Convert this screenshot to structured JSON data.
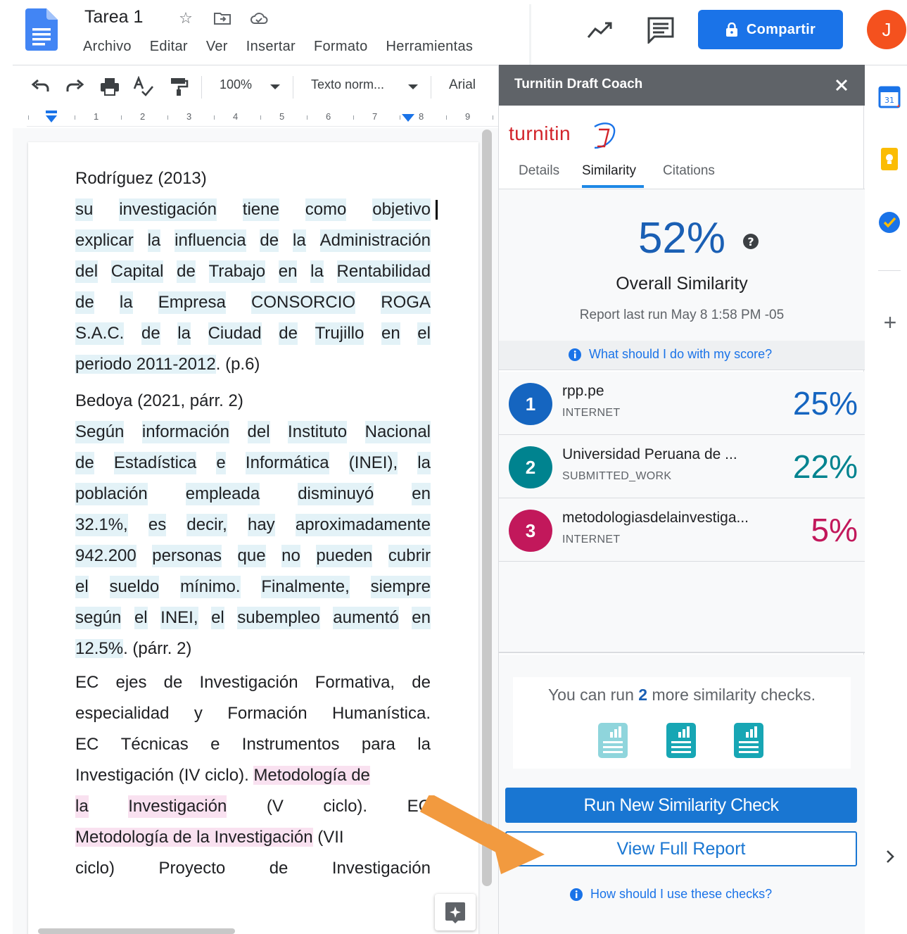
{
  "header": {
    "title": "Tarea 1",
    "menu": [
      "Archivo",
      "Editar",
      "Ver",
      "Insertar",
      "Formato",
      "Herramientas"
    ],
    "share_label": "Compartir",
    "avatar_initial": "J"
  },
  "toolbar": {
    "zoom": "100%",
    "style": "Texto norm...",
    "font": "Arial"
  },
  "ruler": {
    "numbers": [
      "1",
      "2",
      "3",
      "4",
      "5",
      "6",
      "7",
      "8",
      "9"
    ]
  },
  "document": {
    "lines": [
      {
        "segments": [
          {
            "text": "Rodríguez (2013)",
            "hl": ""
          }
        ],
        "justify": false
      },
      {
        "segments": [
          {
            "text": "su investigación tiene como objetivo",
            "hl": "blue"
          }
        ],
        "justify": true
      },
      {
        "segments": [
          {
            "text": "explicar la influencia de la Administración",
            "hl": "blue"
          }
        ],
        "justify": true
      },
      {
        "segments": [
          {
            "text": "del Capital de Trabajo en la Rentabilidad",
            "hl": "blue"
          }
        ],
        "justify": true
      },
      {
        "segments": [
          {
            "text": "de la Empresa CONSORCIO ROGA",
            "hl": "blue"
          }
        ],
        "justify": true
      },
      {
        "segments": [
          {
            "text": "S.A.C. de la Ciudad de Trujillo en el",
            "hl": "blue"
          }
        ],
        "justify": true
      },
      {
        "segments": [
          {
            "text": "periodo 2011-2012",
            "hl": "blue"
          },
          {
            "text": ". (p.6)",
            "hl": ""
          }
        ],
        "justify": false
      },
      {
        "segments": [
          {
            "text": "Bedoya (2021, párr. 2)",
            "hl": ""
          }
        ],
        "justify": false
      },
      {
        "segments": [
          {
            "text": "Según información del Instituto Nacional",
            "hl": "blue"
          }
        ],
        "justify": true
      },
      {
        "segments": [
          {
            "text": "de Estadística e Informática (INEI), la",
            "hl": "blue"
          }
        ],
        "justify": true
      },
      {
        "segments": [
          {
            "text": "población empleada disminuyó en",
            "hl": "blue"
          }
        ],
        "justify": true
      },
      {
        "segments": [
          {
            "text": "32.1%, es decir, hay aproximadamente",
            "hl": "blue"
          }
        ],
        "justify": true
      },
      {
        "segments": [
          {
            "text": "942.200 personas que no pueden cubrir",
            "hl": "blue"
          }
        ],
        "justify": true
      },
      {
        "segments": [
          {
            "text": "el sueldo mínimo. Finalmente, siempre",
            "hl": "blue"
          }
        ],
        "justify": true
      },
      {
        "segments": [
          {
            "text": "según el INEI, el subempleo aumentó en",
            "hl": "blue"
          }
        ],
        "justify": true
      },
      {
        "segments": [
          {
            "text": "12.5%",
            "hl": "blue"
          },
          {
            "text": ". (párr. 2)",
            "hl": ""
          }
        ],
        "justify": false
      },
      {
        "segments": [
          {
            "text": "EC ejes de Investigación Formativa, de",
            "hl": ""
          }
        ],
        "justify": true
      },
      {
        "segments": [
          {
            "text": "especialidad y Formación Humanística.",
            "hl": ""
          }
        ],
        "justify": true
      },
      {
        "segments": [
          {
            "text": "EC Técnicas e Instrumentos para la",
            "hl": ""
          }
        ],
        "justify": true
      },
      {
        "segments": [
          {
            "text": "Investigación (IV ciclo). ",
            "hl": ""
          },
          {
            "text": "Metodología de",
            "hl": "pink"
          }
        ],
        "justify": false
      },
      {
        "segments": [
          {
            "text": "la",
            "hl": "pink"
          },
          {
            "text": "Investigación",
            "hl": "pink"
          },
          {
            "text": "(V",
            "hl": ""
          },
          {
            "text": "ciclo).",
            "hl": ""
          },
          {
            "text": "EC",
            "hl": ""
          }
        ],
        "justify": true,
        "split": true
      },
      {
        "segments": [
          {
            "text": "Metodología de la Investigación",
            "hl": "pink"
          },
          {
            "text": " (VII",
            "hl": ""
          }
        ],
        "justify": false
      },
      {
        "segments": [
          {
            "text": "ciclo)",
            "hl": ""
          },
          {
            "text": "Proyecto",
            "hl": ""
          },
          {
            "text": "de",
            "hl": ""
          },
          {
            "text": "Investigación",
            "hl": ""
          }
        ],
        "justify": true,
        "split": true
      }
    ]
  },
  "turnitin": {
    "panel_title": "Turnitin Draft Coach",
    "logo_text": "turnitin",
    "tabs": [
      "Details",
      "Similarity",
      "Citations"
    ],
    "active_tab": "Similarity",
    "score": "52%",
    "score_label": "Overall Similarity",
    "report_run": "Report last run May 8 1:58 PM -05",
    "score_help": "What should I do with my score?",
    "sources": [
      {
        "rank": "1",
        "name": "rpp.pe",
        "type": "INTERNET",
        "pct": "25%",
        "color": "#1565c0"
      },
      {
        "rank": "2",
        "name": "Universidad Peruana de ...",
        "type": "SUBMITTED_WORK",
        "pct": "22%",
        "color": "#00838f"
      },
      {
        "rank": "3",
        "name": "metodologiasdelainvestiga...",
        "type": "INTERNET",
        "pct": "5%",
        "color": "#c2185b"
      }
    ],
    "checks_prefix": "You can run ",
    "checks_count": "2",
    "checks_suffix": " more similarity checks.",
    "run_button": "Run New Similarity Check",
    "view_button": "View Full Report",
    "checks_help": "How should I use these checks?"
  },
  "colors": {
    "accent_blue": "#1a73e8",
    "highlight_blue": "#e3f2f7",
    "highlight_pink": "#f9e1f0",
    "arrow_orange": "#f29a3f"
  }
}
